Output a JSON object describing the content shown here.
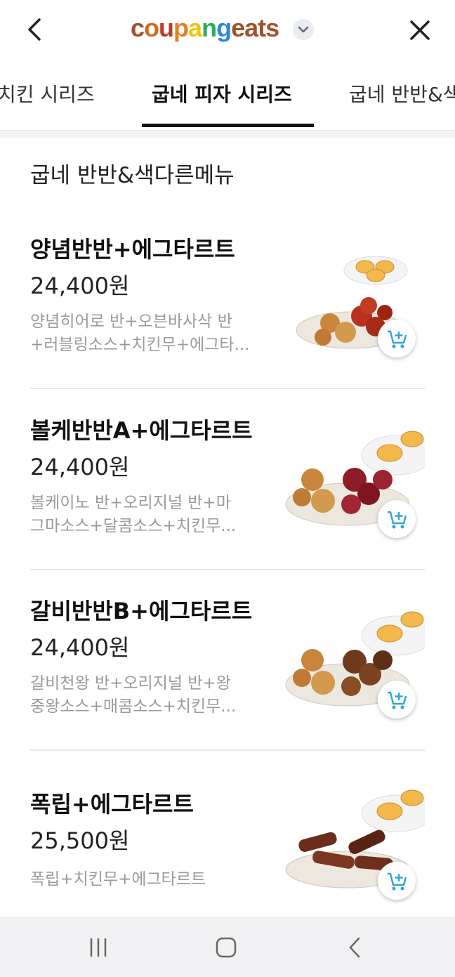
{
  "header": {
    "logo_parts": [
      "coupang",
      " eats"
    ],
    "back_icon": "chevron-left-icon",
    "close_icon": "close-icon",
    "dropdown_icon": "chevron-down-icon"
  },
  "tabs": [
    {
      "label": "치킨 시리즈",
      "active": false
    },
    {
      "label": "굽네 피자 시리즈",
      "active": true
    },
    {
      "label": "굽네 반반&색다른메뉴",
      "active": false
    }
  ],
  "section": {
    "title": "굽네 반반&색다른메뉴"
  },
  "items": [
    {
      "name": "양념반반+에그타르트",
      "price": "24,400원",
      "desc_line1": "양념히어로 반+오븐바사삭 반",
      "desc_line2": "+러블링소스+치킨무+에그타..."
    },
    {
      "name": "볼케반반A+에그타르트",
      "price": "24,400원",
      "desc_line1": "볼케이노 반+오리지널 반+마",
      "desc_line2": "그마소스+달콤소스+치킨무..."
    },
    {
      "name": "갈비반반B+에그타르트",
      "price": "24,400원",
      "desc_line1": "갈비천왕 반+오리지널 반+왕",
      "desc_line2": "중왕소스+매콤소스+치킨무..."
    },
    {
      "name": "폭립+에그타르트",
      "price": "25,500원",
      "desc_line1": "폭립+치킨무+에그타르트",
      "desc_line2": ""
    }
  ],
  "colors": {
    "logo_coupang": [
      "#a0522d",
      "#d2691e",
      "#c0392b",
      "#e67e22",
      "#f1c40f",
      "#27ae60",
      "#2e86de"
    ],
    "logo_eats": "#a0522d",
    "cart_icon": "#2ea6d6",
    "tab_underline": "#111111"
  },
  "navbar": {
    "recents_icon": "recent-apps-icon",
    "home_icon": "home-icon",
    "back_icon": "back-icon"
  }
}
